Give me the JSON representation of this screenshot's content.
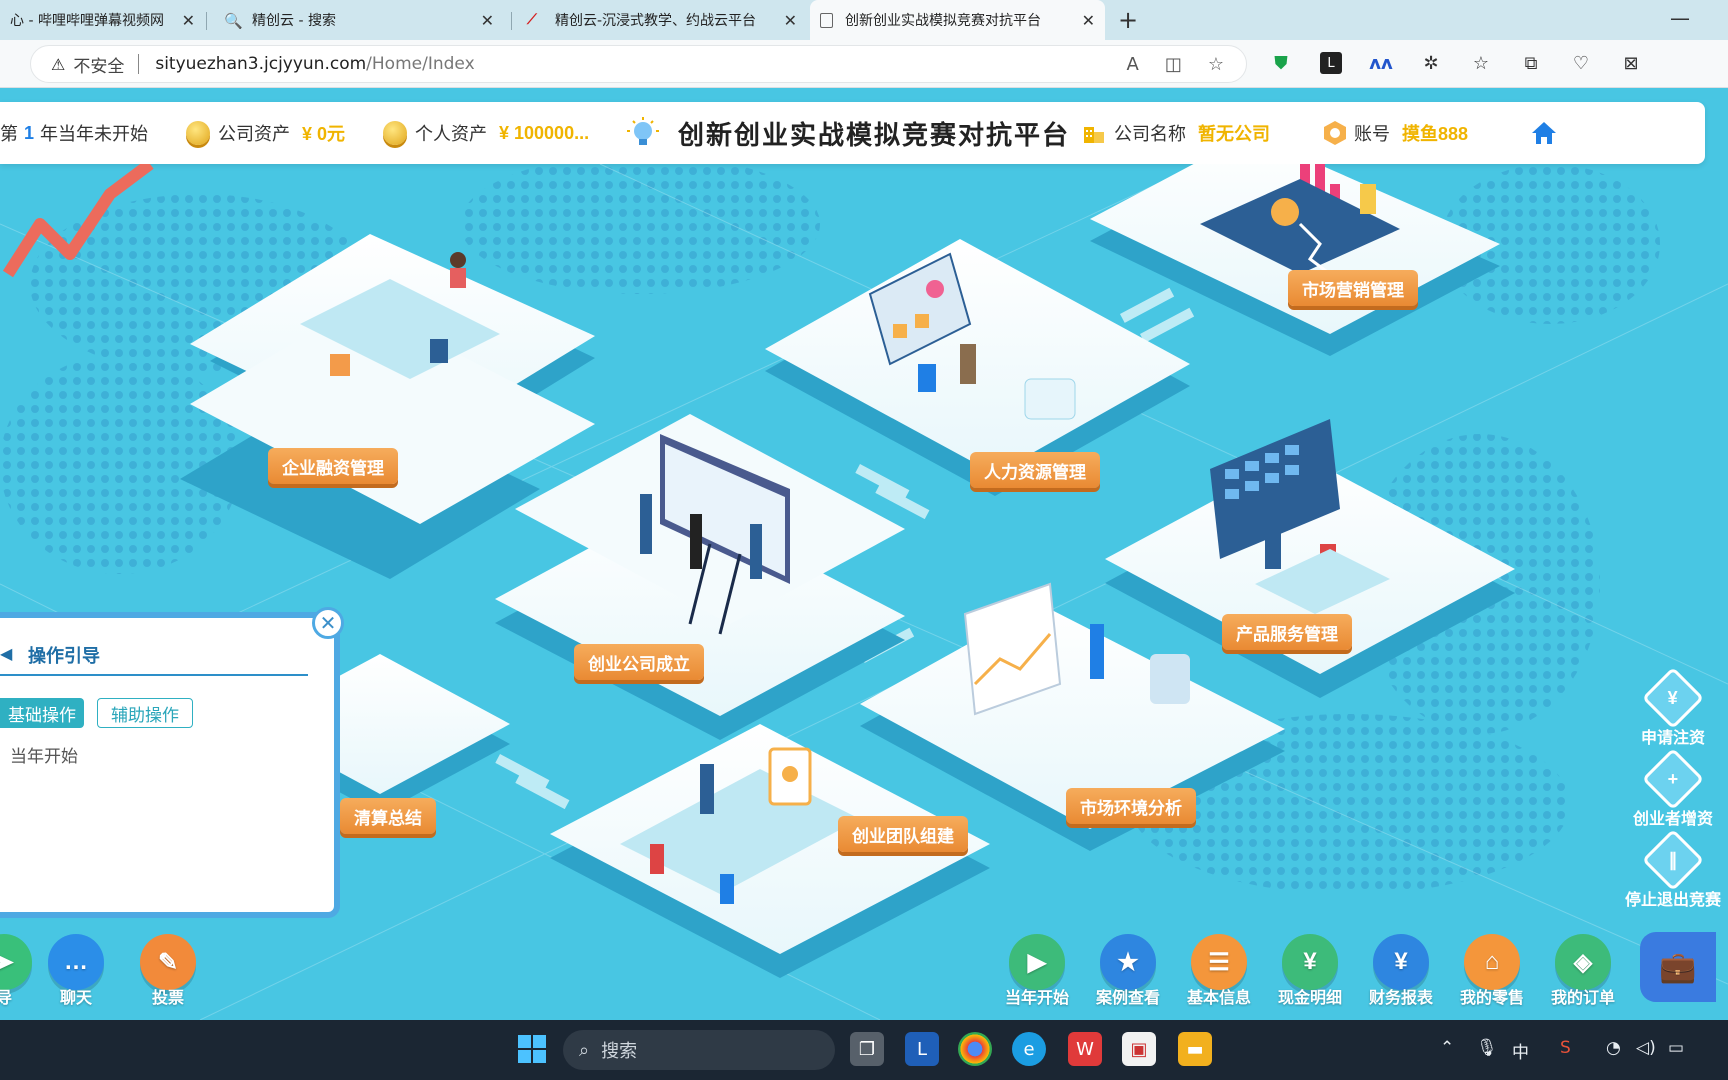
{
  "browser": {
    "tabs": [
      {
        "title": "心 - 哔哩哔哩弹幕视频网"
      },
      {
        "title": "精创云 - 搜索"
      },
      {
        "title": "精创云-沉浸式教学、约战云平台"
      },
      {
        "title": "创新创业实战模拟竞赛对抗平台"
      }
    ],
    "address": {
      "insecure_label": "不安全",
      "host": "sityuezhan3.jcjyyun.com",
      "path": "/Home/Index"
    }
  },
  "header": {
    "year_prefix": "第",
    "year_number": "1",
    "year_status": "年当年未开始",
    "company_assets_label": "公司资产",
    "company_assets_value": "¥ 0元",
    "personal_assets_label": "个人资产",
    "personal_assets_value": "¥ 100000...",
    "title": "创新创业实战模拟竞赛对抗平台",
    "company_name_label": "公司名称",
    "company_name_value": "暂无公司",
    "account_label": "账号",
    "account_value": "摸鱼888"
  },
  "platforms": {
    "financing": "企业融资管理",
    "hr": "人力资源管理",
    "marketing": "市场营销管理",
    "founding": "创业公司成立",
    "product": "产品服务管理",
    "settlement": "清算总结",
    "team": "创业团队组建",
    "market_env": "市场环境分析"
  },
  "guide": {
    "title": "操作引导",
    "tab_basic": "基础操作",
    "tab_aux": "辅助操作",
    "step": "当年开始"
  },
  "side_actions": [
    {
      "label": "申请注资",
      "glyph": "¥"
    },
    {
      "label": "创业者增资",
      "glyph": "+"
    },
    {
      "label": "停止退出竞赛",
      "glyph": "∥"
    }
  ],
  "bottom_left": [
    {
      "label": "导",
      "color": "#39c07a"
    },
    {
      "label": "聊天",
      "color": "#2b8ee8"
    },
    {
      "label": "投票",
      "color": "#f28a3a"
    }
  ],
  "bottom_right": [
    {
      "label": "当年开始",
      "color": "#3dbb7a"
    },
    {
      "label": "案例查看",
      "color": "#2e86e0"
    },
    {
      "label": "基本信息",
      "color": "#f4963b"
    },
    {
      "label": "现金明细",
      "color": "#3dbb7a"
    },
    {
      "label": "财务报表",
      "color": "#2e86e0"
    },
    {
      "label": "我的零售",
      "color": "#f4963b"
    },
    {
      "label": "我的订单",
      "color": "#3dbb7a"
    }
  ],
  "taskbar": {
    "search_placeholder": "搜索",
    "ime": "中"
  }
}
